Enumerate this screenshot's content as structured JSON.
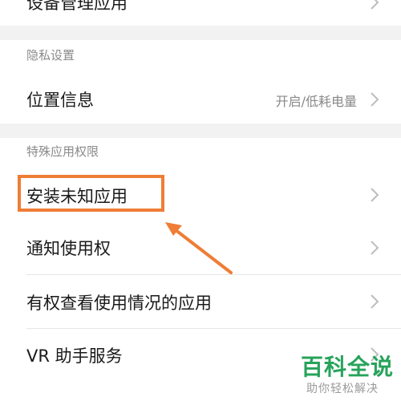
{
  "top_row": {
    "label": "设备管理应用"
  },
  "privacy_section": {
    "header": "隐私设置",
    "items": [
      {
        "label": "位置信息",
        "value": "开启/低耗电量"
      }
    ]
  },
  "special_section": {
    "header": "特殊应用权限",
    "items": [
      {
        "label": "安装未知应用"
      },
      {
        "label": "通知使用权"
      },
      {
        "label": "有权查看使用情况的应用"
      },
      {
        "label": "VR 助手服务"
      }
    ]
  },
  "annotation": {
    "highlight_color": "#ef7d35"
  },
  "watermark": {
    "title": "百科全说",
    "subtitle": "助你轻松解决"
  }
}
